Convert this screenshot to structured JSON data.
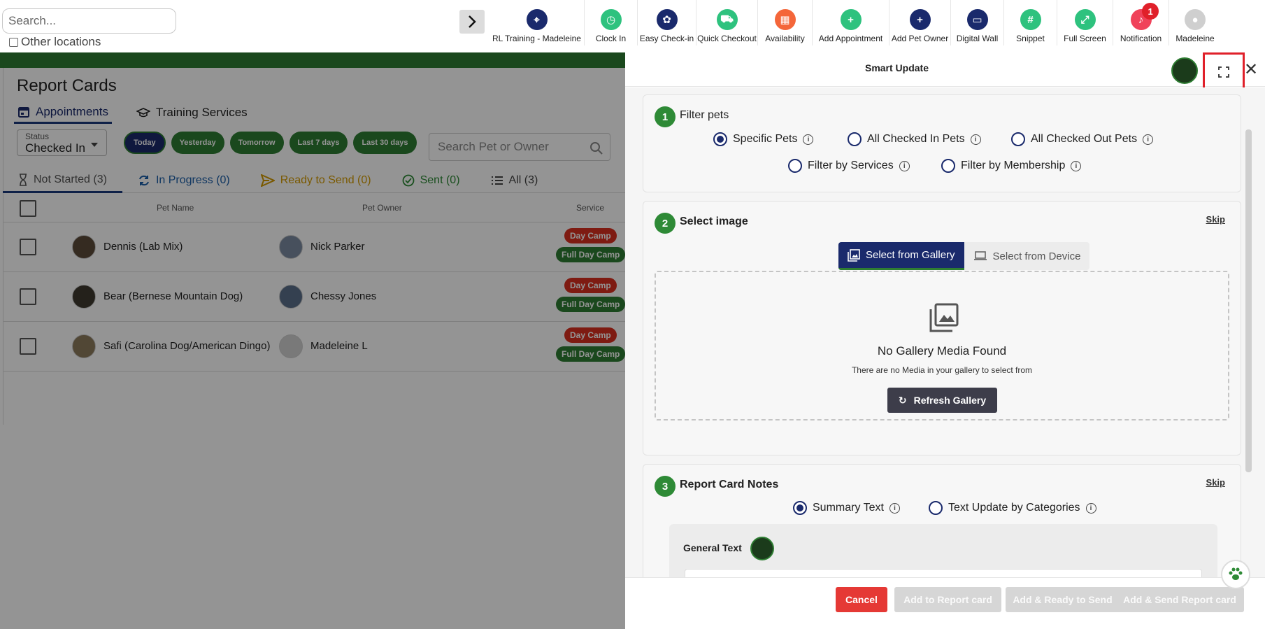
{
  "search": {
    "placeholder": "Search..."
  },
  "other_locations": "Other locations",
  "toolbar": [
    {
      "label": "RL Training - Madeleine",
      "icon": "location-pin-icon",
      "color": "#1a2a6c"
    },
    {
      "label": "Clock In",
      "icon": "clock-icon",
      "color": "#2ec27e"
    },
    {
      "label": "Easy Check-in",
      "icon": "paw-icon",
      "color": "#1a2a6c"
    },
    {
      "label": "Quick Checkout",
      "icon": "cart-icon",
      "color": "#2ec27e"
    },
    {
      "label": "Availability",
      "icon": "calendar-icon",
      "color": "#f4663a"
    },
    {
      "label": "Add Appointment",
      "icon": "add-calendar-icon",
      "color": "#2ec27e"
    },
    {
      "label": "Add Pet Owner",
      "icon": "add-user-icon",
      "color": "#1a2a6c"
    },
    {
      "label": "Digital Wall",
      "icon": "monitor-icon",
      "color": "#1a2a6c"
    },
    {
      "label": "Snippet",
      "icon": "hash-icon",
      "color": "#2ec27e"
    },
    {
      "label": "Full Screen",
      "icon": "expand-icon",
      "color": "#2ec27e"
    },
    {
      "label": "Notification",
      "icon": "bell-icon",
      "color": "#f0425a",
      "badge": "1"
    },
    {
      "label": "Madeleine",
      "icon": "avatar-icon",
      "color": "#cfcfcf"
    }
  ],
  "report": {
    "title": "Report Cards",
    "tabs": [
      "Appointments",
      "Training Services"
    ],
    "status_label": "Status",
    "status_value": "Checked In",
    "date_filters": [
      "Today",
      "Yesterday",
      "Tomorrow",
      "Last 7 days",
      "Last 30 days"
    ],
    "search_placeholder": "Search Pet or Owner",
    "subtabs": [
      {
        "label": "Not Started (3)",
        "color": "#555555"
      },
      {
        "label": "In Progress (0)",
        "color": "#1a5ea8"
      },
      {
        "label": "Ready to Send (0)",
        "color": "#d39a00"
      },
      {
        "label": "Sent (0)",
        "color": "#2e8a36"
      },
      {
        "label": "All (3)",
        "color": "#444444"
      }
    ],
    "columns": [
      "Pet Name",
      "Pet Owner",
      "Service"
    ],
    "rows": [
      {
        "pet": "Dennis (Lab Mix)",
        "owner": "Nick Parker",
        "tags": [
          "Day Camp",
          "Full Day Camp"
        ]
      },
      {
        "pet": "Bear (Bernese Mountain Dog)",
        "owner": "Chessy Jones",
        "tags": [
          "Day Camp",
          "Full Day Camp"
        ]
      },
      {
        "pet": "Safi (Carolina Dog/American Dingo)",
        "owner": "Madeleine L",
        "tags": [
          "Day Camp",
          "Full Day Camp"
        ]
      }
    ]
  },
  "panel": {
    "title": "Smart Update",
    "s1": {
      "num": "1",
      "title": "Filter pets",
      "options": [
        "Specific Pets",
        "All Checked In Pets",
        "All Checked Out Pets",
        "Filter by Services",
        "Filter by Membership"
      ]
    },
    "s2": {
      "num": "2",
      "title": "Select image",
      "skip": "Skip",
      "seg_gallery": "Select from Gallery",
      "seg_device": "Select from Device",
      "empty_title": "No Gallery Media Found",
      "empty_sub": "There are no Media in your gallery to select from",
      "refresh": "Refresh Gallery"
    },
    "s3": {
      "num": "3",
      "title": "Report Card Notes",
      "skip": "Skip",
      "options": [
        "Summary Text",
        "Text Update by Categories"
      ],
      "general_text": "General Text"
    },
    "footer": {
      "cancel": "Cancel",
      "add_report": "Add to Report card",
      "add_ready": "Add & Ready to Send",
      "add_send": "Add & Send Report card"
    }
  }
}
